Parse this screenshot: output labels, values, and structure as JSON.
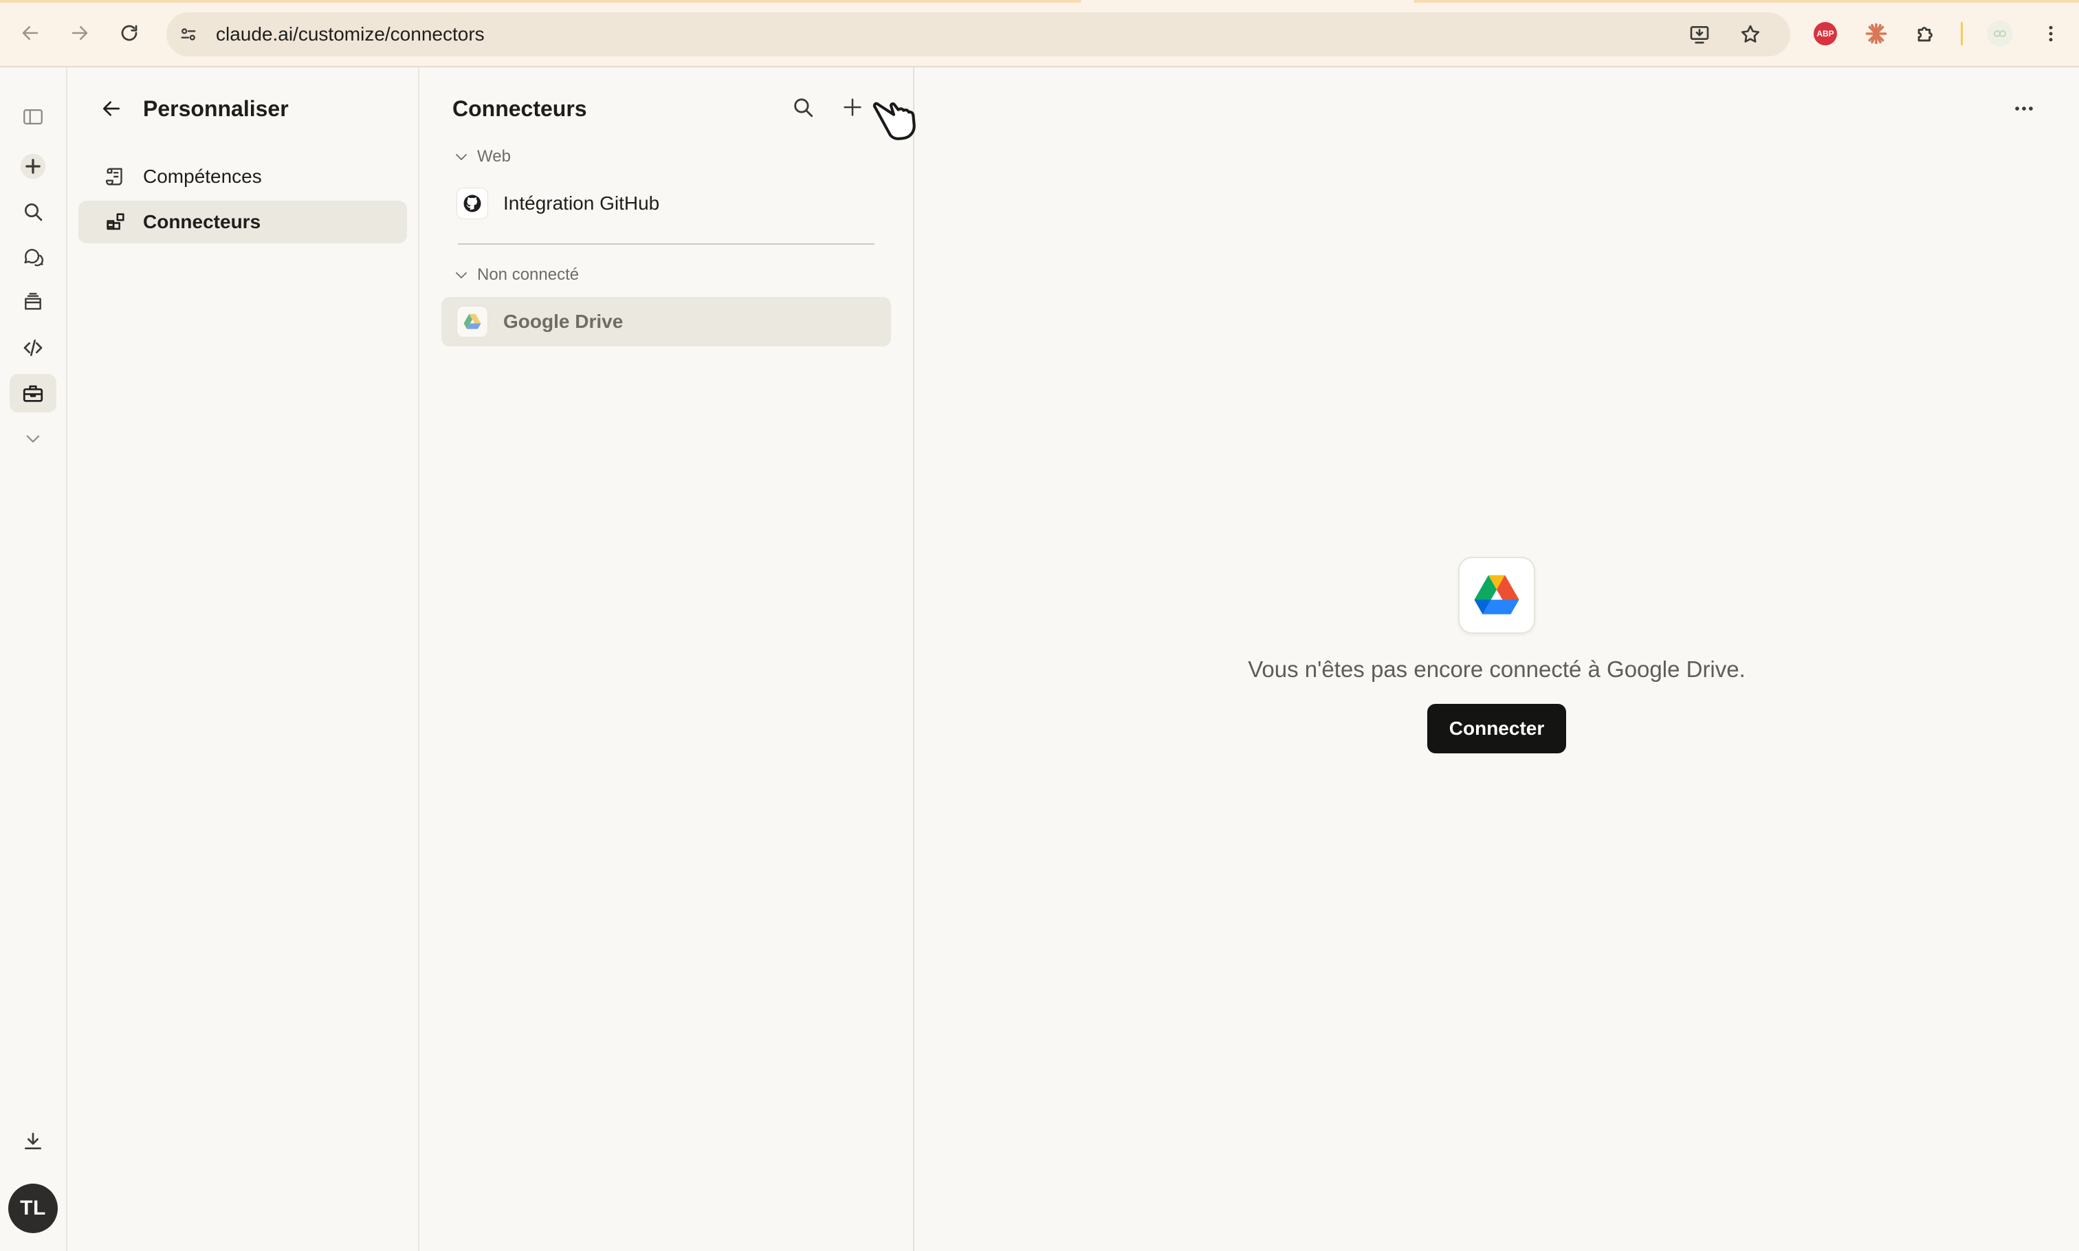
{
  "browser": {
    "url": "claude.ai/customize/connectors",
    "abp_label": "ABP"
  },
  "rail": {
    "avatar_initials": "TL"
  },
  "customize": {
    "title": "Personnaliser",
    "nav": [
      {
        "label": "Compétences"
      },
      {
        "label": "Connecteurs"
      }
    ]
  },
  "connectors": {
    "title": "Connecteurs",
    "sections": [
      {
        "label": "Web",
        "items": [
          {
            "label": "Intégration GitHub"
          }
        ]
      },
      {
        "label": "Non connecté",
        "items": [
          {
            "label": "Google Drive"
          }
        ]
      }
    ]
  },
  "detail": {
    "message": "Vous n'êtes pas encore connecté à Google Drive.",
    "connect_label": "Connecter"
  },
  "colors": {
    "background": "#f9f8f5",
    "chrome": "#fbf3e8",
    "selected": "#ebe8e0",
    "primary_button": "#141413"
  }
}
